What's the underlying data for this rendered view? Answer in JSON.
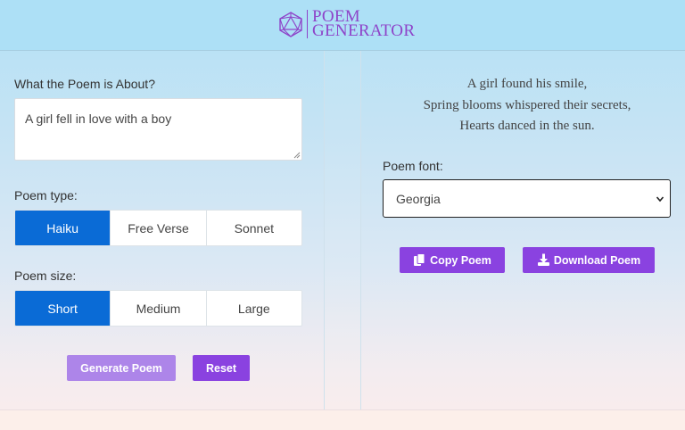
{
  "header": {
    "logo_line1": "POEM",
    "logo_line2": "GENERATOR",
    "brand_color": "#8e44c9"
  },
  "form": {
    "about_label": "What the Poem is About?",
    "about_value": "A girl fell in love with a boy",
    "type_label": "Poem type:",
    "types": [
      "Haiku",
      "Free Verse",
      "Sonnet"
    ],
    "type_selected": "Haiku",
    "size_label": "Poem size:",
    "sizes": [
      "Short",
      "Medium",
      "Large"
    ],
    "size_selected": "Short",
    "generate_label": "Generate Poem",
    "reset_label": "Reset",
    "active_color": "#0a6bd6",
    "button_color": "#8a42e0"
  },
  "output": {
    "poem_lines": [
      "A girl found his smile,",
      "Spring blooms whispered their secrets,",
      "Hearts danced in the sun."
    ],
    "font_label": "Poem font:",
    "font_selected": "Georgia",
    "copy_label": "Copy Poem",
    "download_label": "Download Poem",
    "icons": [
      "copy-icon",
      "download-icon",
      "chevron-down-icon"
    ]
  }
}
